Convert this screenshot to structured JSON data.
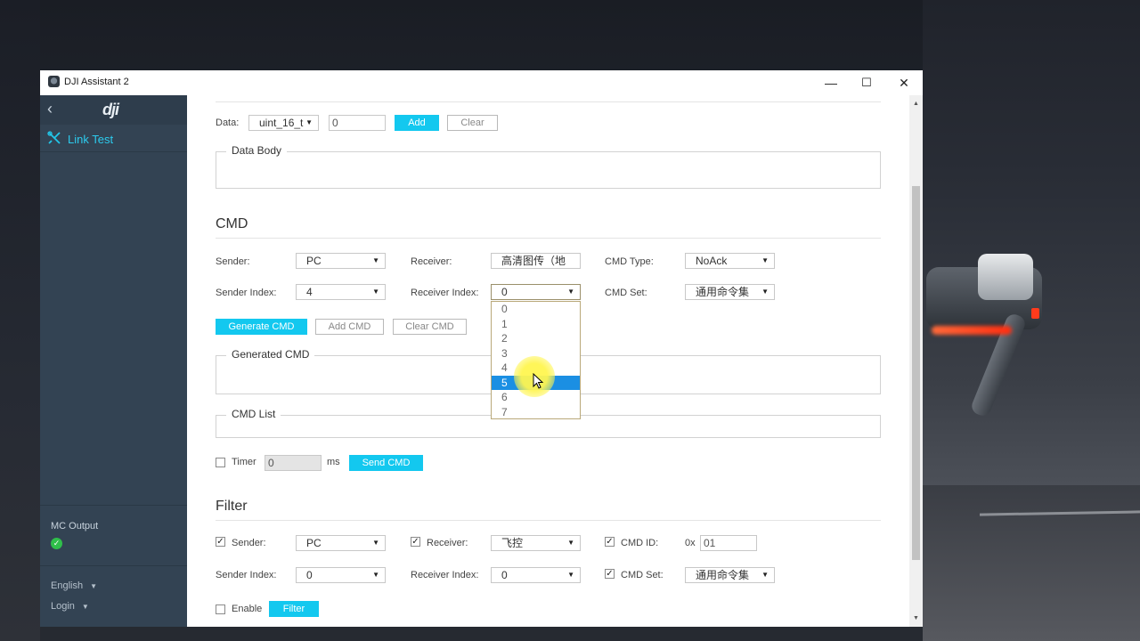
{
  "window": {
    "title": "DJI Assistant 2",
    "minimize": "—",
    "maximize": "☐",
    "close": "✕"
  },
  "sidebar": {
    "back_glyph": "‹",
    "logo_text": "dji",
    "items": [
      {
        "label": "Link Test",
        "icon": "tools-icon"
      }
    ],
    "mc_output_label": "MC Output",
    "mc_status": "ok",
    "language": "English",
    "login": "Login"
  },
  "data_row": {
    "label": "Data:",
    "type_select": "uint_16_t",
    "value": "0",
    "add_label": "Add",
    "clear_label": "Clear"
  },
  "data_body": {
    "legend": "Data Body"
  },
  "cmd": {
    "heading": "CMD",
    "sender_label": "Sender:",
    "sender_value": "PC",
    "receiver_label": "Receiver:",
    "receiver_value": "高清图传（地",
    "cmd_type_label": "CMD Type:",
    "cmd_type_value": "NoAck",
    "sender_index_label": "Sender Index:",
    "sender_index_value": "4",
    "receiver_index_label": "Receiver Index:",
    "receiver_index_value": "0",
    "cmd_set_label": "CMD Set:",
    "cmd_set_value": "通用命令集",
    "generate_label": "Generate CMD",
    "add_label": "Add CMD",
    "clear_label": "Clear CMD",
    "receiver_index_options": [
      "0",
      "1",
      "2",
      "3",
      "4",
      "5",
      "6",
      "7"
    ],
    "receiver_index_highlighted": "5"
  },
  "generated_cmd": {
    "legend": "Generated CMD"
  },
  "cmd_list": {
    "legend": "CMD List"
  },
  "timer": {
    "label": "Timer",
    "value": "0",
    "unit": "ms",
    "send_label": "Send CMD",
    "checked": false
  },
  "filter": {
    "heading": "Filter",
    "sender_label": "Sender:",
    "sender_value": "PC",
    "sender_checked": true,
    "receiver_label": "Receiver:",
    "receiver_value": "飞控",
    "receiver_checked": true,
    "cmd_id_label": "CMD ID:",
    "cmd_id_prefix": "0x",
    "cmd_id_value": "01",
    "cmd_id_checked": true,
    "sender_index_label": "Sender Index:",
    "sender_index_value": "0",
    "receiver_index_label": "Receiver Index:",
    "receiver_index_value": "0",
    "cmd_set_label": "CMD Set:",
    "cmd_set_value": "通用命令集",
    "cmd_set_checked": true,
    "enable_label": "Enable",
    "enable_checked": false,
    "filter_button": "Filter"
  },
  "colors": {
    "accent": "#13c8ef",
    "sidebar": "#334353",
    "selected_option": "#1b8fe3",
    "status_ok": "#2fbf4a"
  }
}
